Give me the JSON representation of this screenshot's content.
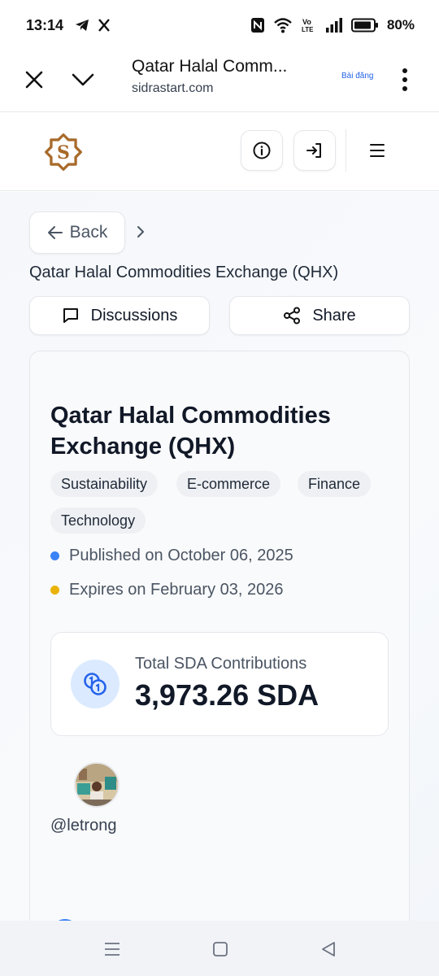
{
  "status_bar": {
    "time": "13:14",
    "battery": "80%",
    "network": "VoLTE"
  },
  "browser": {
    "title": "Qatar Halal Comm...",
    "url": "sidrastart.com",
    "badge": "Bài đăng"
  },
  "header": {
    "logo_letter": "S",
    "colors": {
      "logo": "#a86a2a"
    }
  },
  "page": {
    "back_label": "Back",
    "heading": "Qatar Halal Commodities Exchange (QHX)",
    "discussions_label": "Discussions",
    "share_label": "Share"
  },
  "card": {
    "title": "Qatar Halal Commodities Exchange (QHX)",
    "tags": [
      "Sustainability",
      "E-commerce",
      "Finance",
      "Technology"
    ],
    "published": "Published on October 06, 2025",
    "expires": "Expires on February 03, 2026",
    "contributions_label": "Total SDA Contributions",
    "contributions_value": "3,973.26 SDA",
    "username": "@letrong"
  },
  "colors": {
    "published_dot": "#3b82f6",
    "expires_dot": "#eab308",
    "accent": "#2563eb"
  }
}
